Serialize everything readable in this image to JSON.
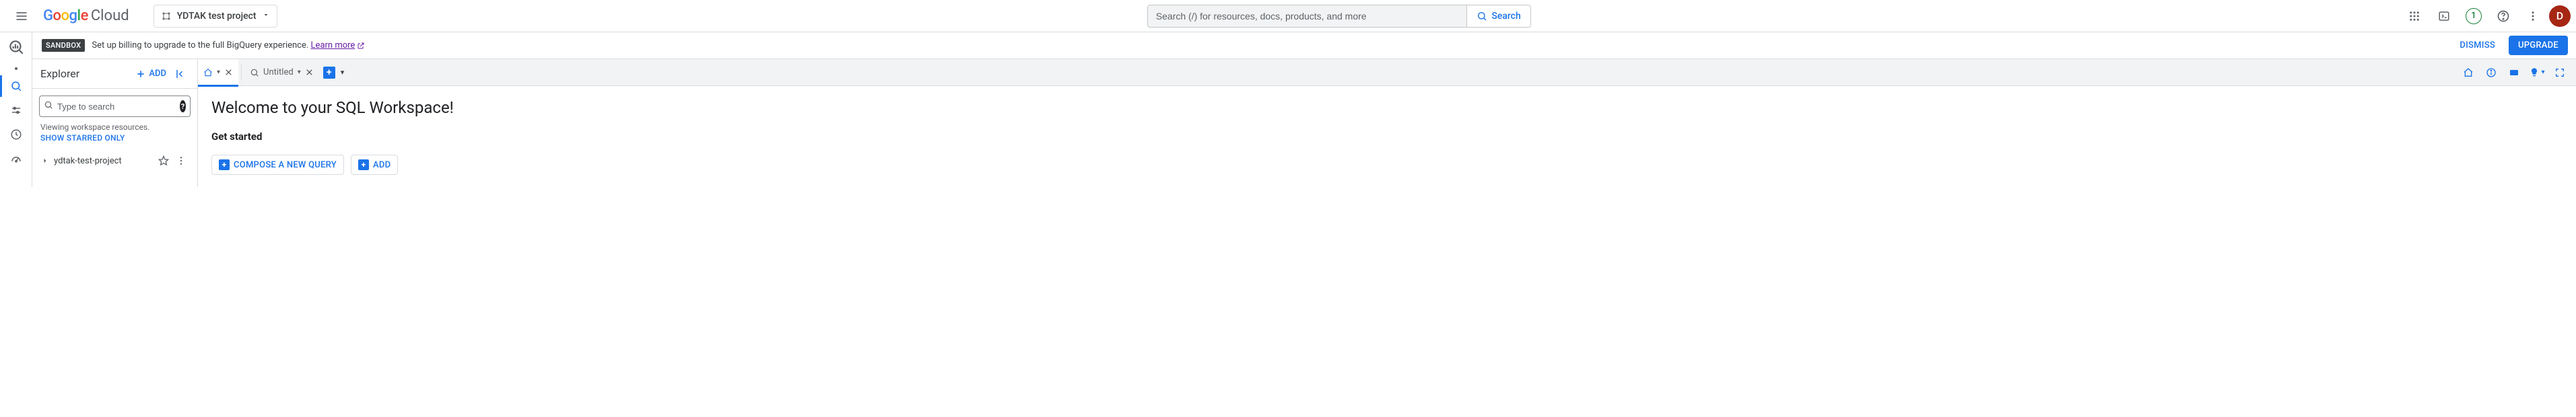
{
  "header": {
    "logo_cloud": "Cloud",
    "project_name": "YDTAK test project",
    "search_placeholder": "Search (/) for resources, docs, products, and more",
    "search_button": "Search",
    "free_trial_badge": "1",
    "avatar_letter": "D"
  },
  "banner": {
    "badge": "SANDBOX",
    "text": "Set up billing to upgrade to the full BigQuery experience.",
    "link": "Learn more",
    "dismiss": "DISMISS",
    "upgrade": "UPGRADE"
  },
  "explorer": {
    "title": "Explorer",
    "add": "ADD",
    "search_placeholder": "Type to search",
    "viewing": "Viewing workspace resources.",
    "starred_only": "SHOW STARRED ONLY",
    "project": "ydtak-test-project"
  },
  "tabs": {
    "untitled": "Untitled"
  },
  "workspace": {
    "title": "Welcome to your SQL Workspace!",
    "subtitle": "Get started",
    "compose": "COMPOSE A NEW QUERY",
    "add": "ADD"
  }
}
